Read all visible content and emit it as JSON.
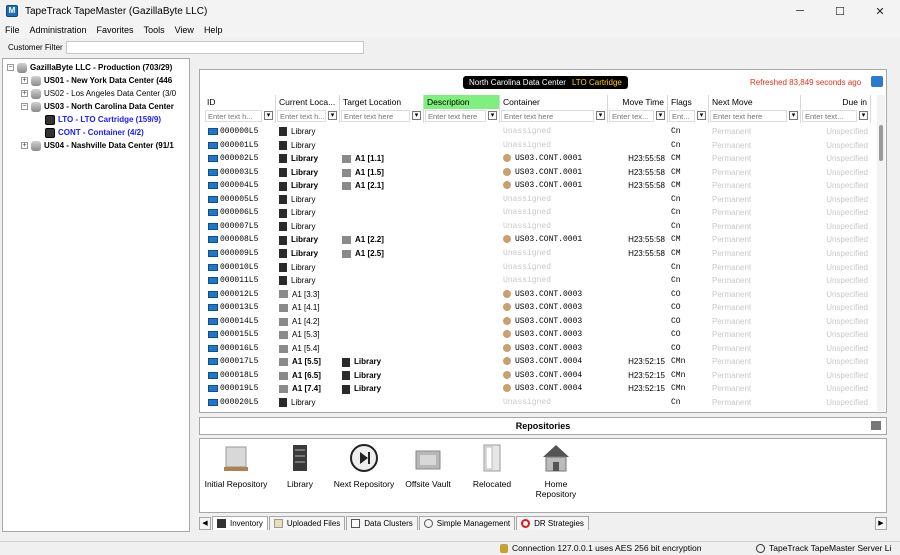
{
  "window": {
    "title": "TapeTrack TapeMaster (GazillaByte LLC)",
    "minimize": "─",
    "maximize": "☐",
    "close": "✕"
  },
  "menu": [
    "File",
    "Administration",
    "Favorites",
    "Tools",
    "View",
    "Help"
  ],
  "customer_filter": {
    "label": "Customer Filter",
    "value": ""
  },
  "tree": [
    {
      "label": "GazillaByte LLC - Production (703/29)",
      "expander": "−",
      "icon": "database-icon"
    },
    {
      "label": "US01 - New York Data Center (446",
      "expander": "+",
      "icon": "database-icon"
    },
    {
      "label": "US02 - Los Angeles Data Center (3/0",
      "expander": "+",
      "icon": "database-icon"
    },
    {
      "label": "US03 - North Carolina Data Center",
      "expander": "−",
      "icon": "database-icon"
    },
    {
      "label": "LTO - LTO Cartridge (159/9)",
      "expander": "",
      "icon": "tape-icon"
    },
    {
      "label": "CONT - Container (4/2)",
      "expander": "",
      "icon": "tape-icon"
    },
    {
      "label": "US04 - Nashville Data Center (91/1",
      "expander": "+",
      "icon": "database-icon"
    }
  ],
  "header": {
    "location": "North Carolina Data Center",
    "media_type": "LTO Cartridge",
    "refreshed": "Refreshed 83,849 seconds ago"
  },
  "columns": [
    {
      "label": "ID",
      "filter": "Enter text h..."
    },
    {
      "label": "Current Loca...",
      "filter": "Enter text h..."
    },
    {
      "label": "Target Location",
      "filter": "Enter text here"
    },
    {
      "label": "Description",
      "filter": "Enter text here"
    },
    {
      "label": "Container",
      "filter": "Enter text here"
    },
    {
      "label": "Move Time",
      "filter": "Enter tex..."
    },
    {
      "label": "Flags",
      "filter": "Ent..."
    },
    {
      "label": "Next Move",
      "filter": "Enter text here"
    },
    {
      "label": "Due in",
      "filter": "Enter text..."
    }
  ],
  "rows": [
    {
      "id": "000000L5",
      "current": "Library",
      "target": "",
      "container": "Unassigned",
      "move_time": "",
      "flags": "Cn",
      "next_move": "Permanent",
      "due": "Unspecified",
      "bold": false
    },
    {
      "id": "000001L5",
      "current": "Library",
      "target": "",
      "container": "Unassigned",
      "move_time": "",
      "flags": "Cn",
      "next_move": "Permanent",
      "due": "Unspecified",
      "bold": false
    },
    {
      "id": "000002L5",
      "current": "Library",
      "target": "A1 [1.1]",
      "container": "US03.CONT.0001",
      "move_time": "H23:55:58",
      "flags": "CM",
      "next_move": "Permanent",
      "due": "Unspecified",
      "bold": true
    },
    {
      "id": "000003L5",
      "current": "Library",
      "target": "A1 [1.5]",
      "container": "US03.CONT.0001",
      "move_time": "H23:55:58",
      "flags": "CM",
      "next_move": "Permanent",
      "due": "Unspecified",
      "bold": true
    },
    {
      "id": "000004L5",
      "current": "Library",
      "target": "A1 [2.1]",
      "container": "US03.CONT.0001",
      "move_time": "H23:55:58",
      "flags": "CM",
      "next_move": "Permanent",
      "due": "Unspecified",
      "bold": true
    },
    {
      "id": "000005L5",
      "current": "Library",
      "target": "",
      "container": "Unassigned",
      "move_time": "",
      "flags": "Cn",
      "next_move": "Permanent",
      "due": "Unspecified",
      "bold": false
    },
    {
      "id": "000006L5",
      "current": "Library",
      "target": "",
      "container": "Unassigned",
      "move_time": "",
      "flags": "Cn",
      "next_move": "Permanent",
      "due": "Unspecified",
      "bold": false
    },
    {
      "id": "000007L5",
      "current": "Library",
      "target": "",
      "container": "Unassigned",
      "move_time": "",
      "flags": "Cn",
      "next_move": "Permanent",
      "due": "Unspecified",
      "bold": false
    },
    {
      "id": "000008L5",
      "current": "Library",
      "target": "A1 [2.2]",
      "container": "US03.CONT.0001",
      "move_time": "H23:55:58",
      "flags": "CM",
      "next_move": "Permanent",
      "due": "Unspecified",
      "bold": true
    },
    {
      "id": "000009L5",
      "current": "Library",
      "target": "A1 [2.5]",
      "container": "Unassigned",
      "move_time": "H23:55:58",
      "flags": "CM",
      "next_move": "Permanent",
      "due": "Unspecified",
      "bold": true
    },
    {
      "id": "000010L5",
      "current": "Library",
      "target": "",
      "container": "Unassigned",
      "move_time": "",
      "flags": "Cn",
      "next_move": "Permanent",
      "due": "Unspecified",
      "bold": false
    },
    {
      "id": "000011L5",
      "current": "Library",
      "target": "",
      "container": "Unassigned",
      "move_time": "",
      "flags": "Cn",
      "next_move": "Permanent",
      "due": "Unspecified",
      "bold": false
    },
    {
      "id": "000012L5",
      "current": "A1 [3.3]",
      "target": "",
      "container": "US03.CONT.0003",
      "move_time": "",
      "flags": "CO",
      "next_move": "Permanent",
      "due": "Unspecified",
      "bold": false
    },
    {
      "id": "000013L5",
      "current": "A1 [4.1]",
      "target": "",
      "container": "US03.CONT.0003",
      "move_time": "",
      "flags": "CO",
      "next_move": "Permanent",
      "due": "Unspecified",
      "bold": false
    },
    {
      "id": "000014L5",
      "current": "A1 [4.2]",
      "target": "",
      "container": "US03.CONT.0003",
      "move_time": "",
      "flags": "CO",
      "next_move": "Permanent",
      "due": "Unspecified",
      "bold": false
    },
    {
      "id": "000015L5",
      "current": "A1 [5.3]",
      "target": "",
      "container": "US03.CONT.0003",
      "move_time": "",
      "flags": "CO",
      "next_move": "Permanent",
      "due": "Unspecified",
      "bold": false
    },
    {
      "id": "000016L5",
      "current": "A1 [5.4]",
      "target": "",
      "container": "US03.CONT.0003",
      "move_time": "",
      "flags": "CO",
      "next_move": "Permanent",
      "due": "Unspecified",
      "bold": false
    },
    {
      "id": "000017L5",
      "current": "A1 [5.5]",
      "target": "Library",
      "container": "US03.CONT.0004",
      "move_time": "H23:52:15",
      "flags": "CMn",
      "next_move": "Permanent",
      "due": "Unspecified",
      "bold": true
    },
    {
      "id": "000018L5",
      "current": "A1 [6.5]",
      "target": "Library",
      "container": "US03.CONT.0004",
      "move_time": "H23:52:15",
      "flags": "CMn",
      "next_move": "Permanent",
      "due": "Unspecified",
      "bold": true
    },
    {
      "id": "000019L5",
      "current": "A1 [7.4]",
      "target": "Library",
      "container": "US03.CONT.0004",
      "move_time": "H23:52:15",
      "flags": "CMn",
      "next_move": "Permanent",
      "due": "Unspecified",
      "bold": true
    },
    {
      "id": "000020L5",
      "current": "Library",
      "target": "",
      "container": "Unassigned",
      "move_time": "",
      "flags": "Cn",
      "next_move": "Permanent",
      "due": "Unspecified",
      "bold": false
    }
  ],
  "repositories": {
    "title": "Repositories",
    "items": [
      {
        "label": "Initial Repository",
        "icon": "pallet-icon"
      },
      {
        "label": "Library",
        "icon": "library-icon"
      },
      {
        "label": "Next Repository",
        "icon": "next-icon"
      },
      {
        "label": "Offsite Vault",
        "icon": "vault-icon"
      },
      {
        "label": "Relocated",
        "icon": "door-icon"
      },
      {
        "label": "Home Repository",
        "icon": "house-icon"
      }
    ]
  },
  "tabs": [
    {
      "label": "Inventory",
      "active": true
    },
    {
      "label": "Uploaded Files",
      "active": false
    },
    {
      "label": "Data Clusters",
      "active": false
    },
    {
      "label": "Simple Management",
      "active": false
    },
    {
      "label": "DR Strategies",
      "active": false
    }
  ],
  "status": {
    "connection": "Connection 127.0.0.1 uses AES 256 bit encryption",
    "server": "TapeTrack TapeMaster Server Li"
  },
  "colors": {
    "accent": "#1f77c9",
    "description_header": "#7ff07f",
    "refreshed_text": "#e0301e",
    "selected_tree": "#1a1aff"
  }
}
